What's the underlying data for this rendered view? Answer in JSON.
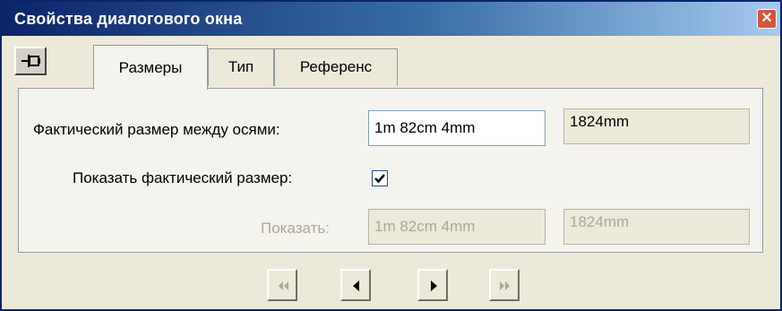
{
  "window": {
    "title": "Свойства диалогового окна",
    "close_glyph": "✕"
  },
  "tabs": [
    {
      "label": "Размеры",
      "active": true
    },
    {
      "label": "Тип",
      "active": false
    },
    {
      "label": "Референс",
      "active": false
    }
  ],
  "dimensions": {
    "actual_size_label": "Фактический размер между осями:",
    "actual_size_value": "1m 82cm 4mm",
    "actual_size_mm": "1824mm",
    "show_actual_label": "Показать фактический размер:",
    "show_actual_checked": true,
    "show_label": "Показать:",
    "show_value": "1m 82cm 4mm",
    "show_mm": "1824mm"
  },
  "navigation": {
    "first_icon": "first-page-icon",
    "prev_icon": "previous-page-icon",
    "next_icon": "next-page-icon",
    "last_icon": "last-page-icon"
  },
  "colors": {
    "titlebar_start": "#0a246a",
    "titlebar_end": "#a6caf0",
    "close_button": "#d6543b",
    "disabled_text": "#aca899"
  }
}
